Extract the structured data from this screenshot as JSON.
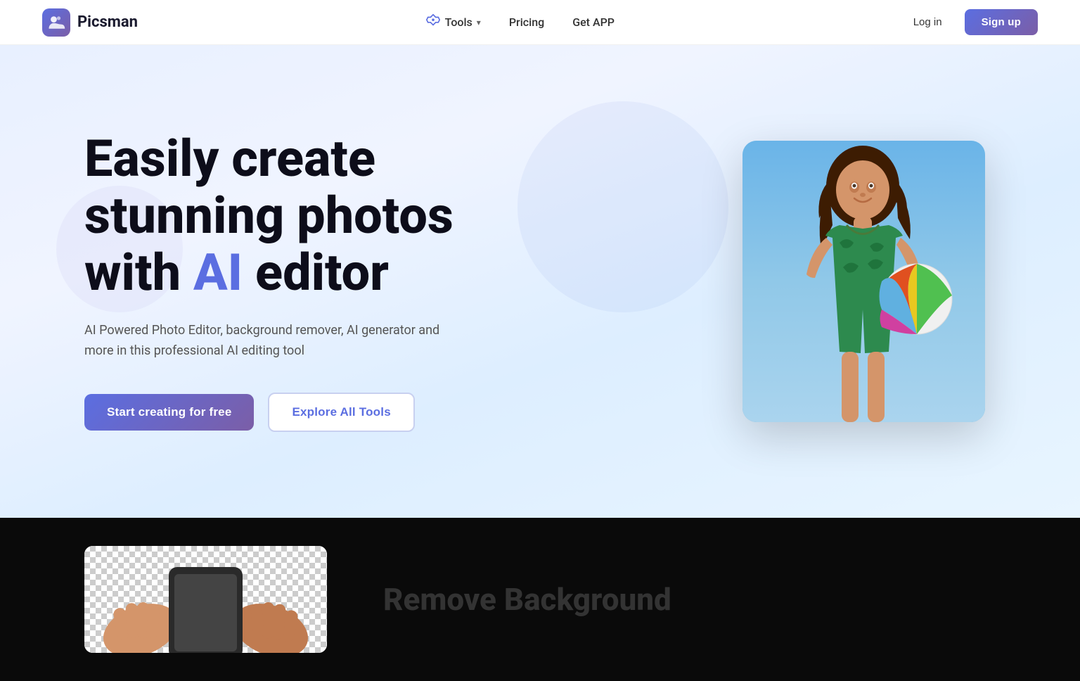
{
  "navbar": {
    "logo_text": "Picsman",
    "tools_label": "Tools",
    "pricing_label": "Pricing",
    "get_app_label": "Get APP",
    "login_label": "Log in",
    "signup_label": "Sign up"
  },
  "hero": {
    "title_part1": "Easily create stunning photos with ",
    "title_ai": "AI",
    "title_part2": " editor",
    "subtitle": "AI Powered Photo Editor, background remover, AI generator and more in this professional AI editing tool",
    "btn_primary": "Start creating for free",
    "btn_outline": "Explore All Tools"
  },
  "bottom": {
    "section_title": "Remove Background"
  }
}
